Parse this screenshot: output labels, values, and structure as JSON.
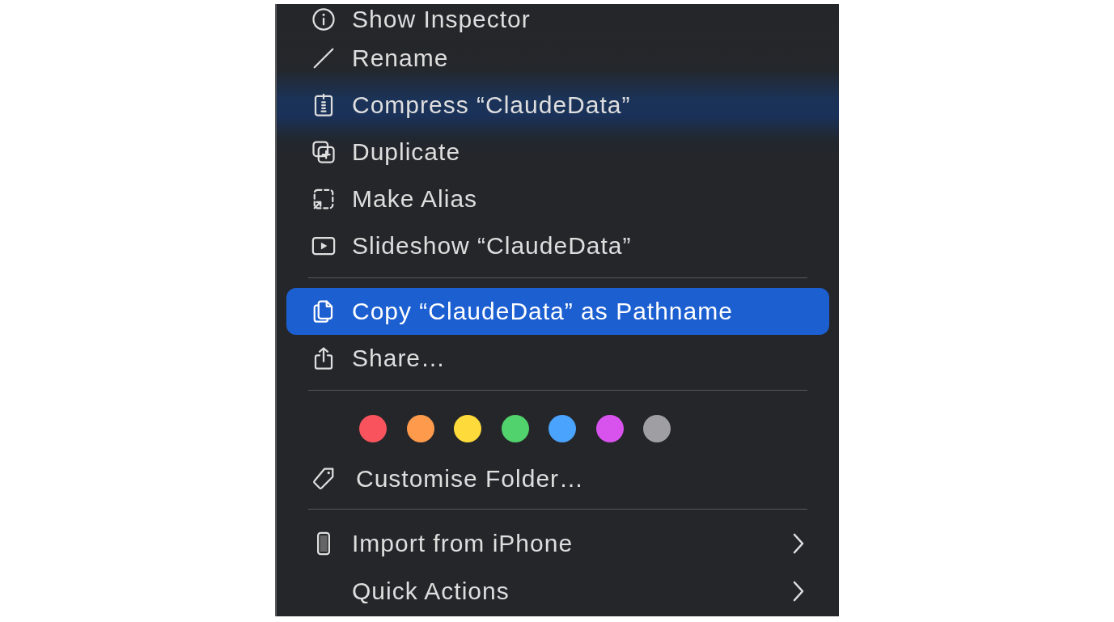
{
  "menu": {
    "sections": [
      {
        "items": [
          {
            "kind": "action",
            "label": "Show Inspector",
            "selected": false
          },
          {
            "kind": "action",
            "label": "Rename",
            "selected": false
          },
          {
            "kind": "action",
            "label": "Compress “ClaudeData”",
            "selected": false
          },
          {
            "kind": "action",
            "label": "Duplicate",
            "selected": false
          },
          {
            "kind": "action",
            "label": "Make Alias",
            "selected": false
          },
          {
            "kind": "action",
            "label": "Slideshow “ClaudeData”",
            "selected": false
          }
        ]
      },
      {
        "items": [
          {
            "kind": "action",
            "label": "Copy “ClaudeData” as Pathname",
            "selected": true
          },
          {
            "kind": "action",
            "label": "Share…",
            "selected": false
          }
        ]
      },
      {
        "items": [
          {
            "kind": "tags",
            "tags": [
              {
                "color": "#f9545d"
              },
              {
                "color": "#fd9a4b"
              },
              {
                "color": "#fedb3b"
              },
              {
                "color": "#51d26d"
              },
              {
                "color": "#4aa3fc"
              },
              {
                "color": "#d853ee"
              },
              {
                "color": "#9f9fa3"
              }
            ]
          },
          {
            "kind": "action",
            "label": "Customise Folder…",
            "selected": false
          }
        ]
      },
      {
        "items": [
          {
            "kind": "submenu",
            "label": "Import from iPhone",
            "selected": false
          },
          {
            "kind": "submenu",
            "label": "Quick Actions",
            "selected": false
          }
        ]
      }
    ]
  }
}
